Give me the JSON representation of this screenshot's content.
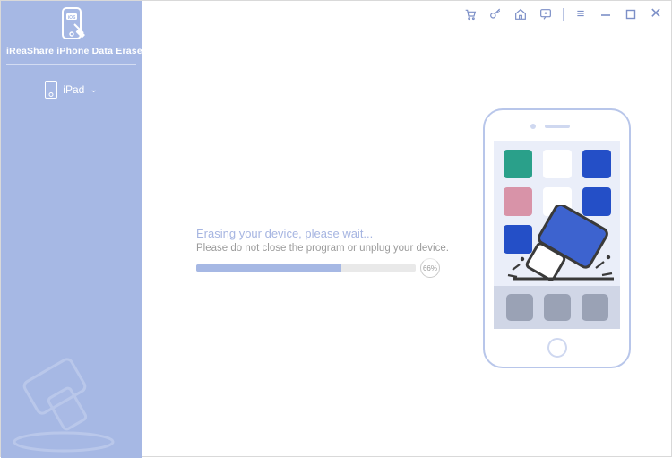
{
  "product": {
    "name": "iReaShare iPhone Data Eraser"
  },
  "sidebar": {
    "device_label": "iPad"
  },
  "titlebar": {
    "icons": [
      "cart-icon",
      "key-icon",
      "home-icon",
      "feedback-icon",
      "menu-icon",
      "minimize-icon",
      "maximize-icon",
      "close-icon"
    ]
  },
  "progress": {
    "status": "Erasing your device, please wait...",
    "warning": "Please do not close the program or unplug your device.",
    "percent": 66,
    "percent_label": "66%"
  },
  "phone": {
    "apps": [
      {
        "color": "c-teal"
      },
      {
        "color": "c-white"
      },
      {
        "color": "c-blue"
      },
      {
        "color": "c-pink"
      },
      {
        "color": "c-white"
      },
      {
        "color": "c-blue"
      },
      {
        "color": "c-blue"
      }
    ]
  },
  "colors": {
    "sidebar": "#a6b8e4",
    "accent_blue": "#244fc7",
    "muted_text": "#9b9b9b"
  }
}
